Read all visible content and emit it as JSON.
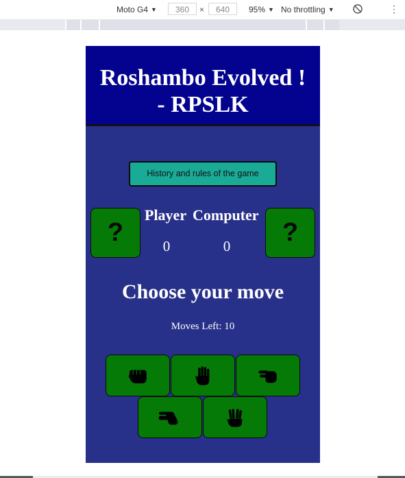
{
  "devtools": {
    "device": "Moto G4",
    "width": "360",
    "height": "640",
    "times": "×",
    "zoom": "95%",
    "throttling": "No throttling"
  },
  "game": {
    "title_line1": "Roshambo Evolved !",
    "title_line2": "- RPSLK",
    "history_button": "History and rules of the game",
    "player_choice": "?",
    "computer_choice": "?",
    "player_label": "Player",
    "computer_label": "Computer",
    "player_score": "0",
    "computer_score": "0",
    "choose_heading": "Choose your move",
    "moves_left": "Moves Left: 10",
    "moves": [
      "rock",
      "paper",
      "scissors",
      "lizard",
      "spock"
    ]
  },
  "colors": {
    "header_bg": "#03038f",
    "body_bg": "#283189",
    "button_green": "#067a06",
    "teal_button": "#1aab97"
  }
}
